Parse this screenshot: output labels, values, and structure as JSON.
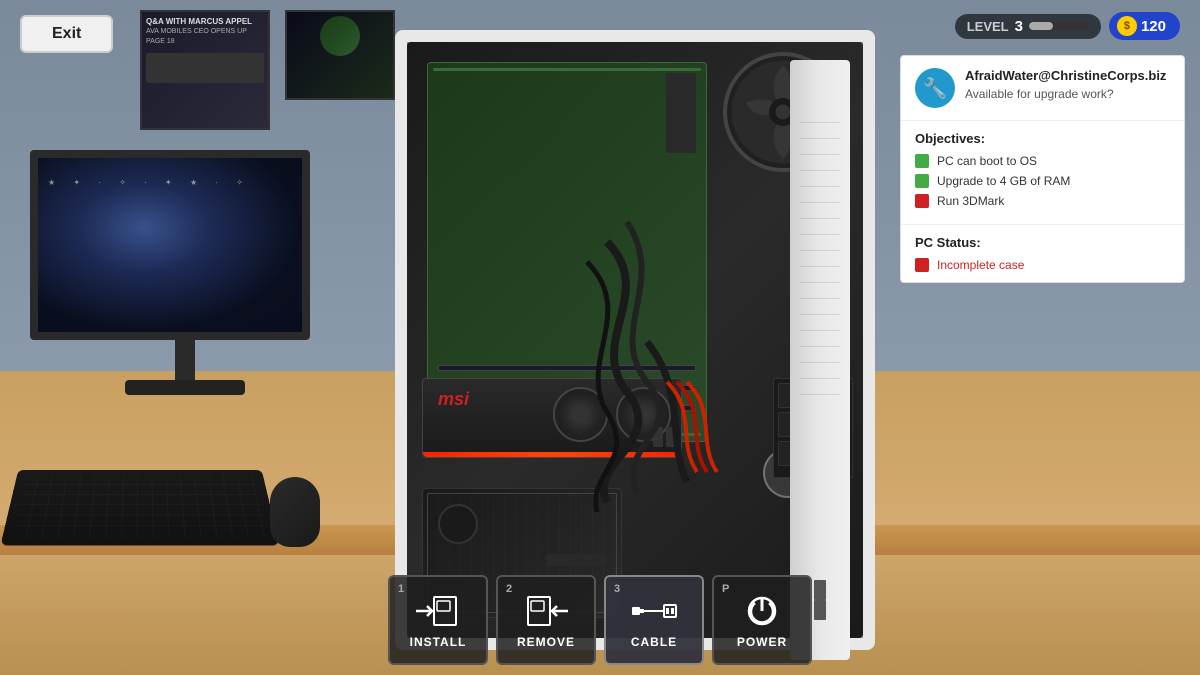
{
  "ui": {
    "exit_button": "Exit",
    "hud": {
      "level_label": "LEVEL",
      "level_value": "3",
      "level_fill_percent": 40,
      "money_symbol": "$",
      "money_amount": "120"
    },
    "mission": {
      "avatar_icon": "🔧",
      "title": "AfraidWater@ChristineCorps.biz",
      "subtitle": "Available for upgrade work?",
      "objectives_label": "Objectives:",
      "objectives": [
        {
          "status": "green",
          "text": "PC can boot to OS"
        },
        {
          "status": "green",
          "text": "Upgrade to 4 GB of RAM"
        },
        {
          "status": "red",
          "text": "Run 3DMark"
        }
      ],
      "pc_status_label": "PC Status:",
      "pc_status": [
        {
          "status": "red",
          "text": "Incomplete case"
        }
      ]
    },
    "toolbar": {
      "tools": [
        {
          "num": "1",
          "label": "INSTALL",
          "icon": "install"
        },
        {
          "num": "2",
          "label": "REMOVE",
          "icon": "remove"
        },
        {
          "num": "3",
          "label": "CABLE",
          "icon": "cable",
          "active": true
        },
        {
          "num": "P",
          "label": "POWER",
          "icon": "power"
        }
      ]
    }
  }
}
